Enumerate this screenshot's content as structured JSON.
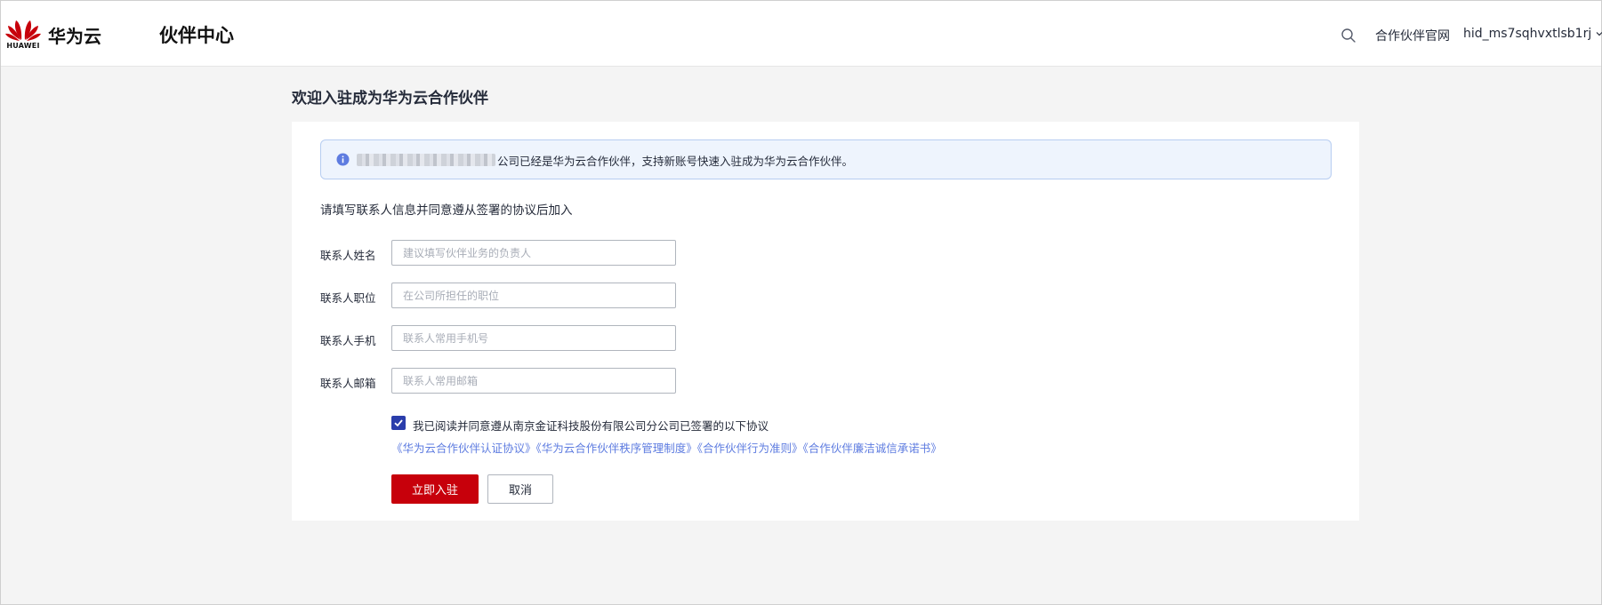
{
  "header": {
    "logo_text": "HUAWEI",
    "brand": "华为云",
    "app_title": "伙伴中心",
    "partner_site_link": "合作伙伴官网",
    "username": "hid_ms7sqhvxtlsb1rj",
    "icons": {
      "search": "search-icon",
      "user_menu": "chevron-down-icon"
    }
  },
  "page": {
    "title": "欢迎入驻成为华为云合作伙伴"
  },
  "alert": {
    "icon": "info-icon",
    "text": "公司已经是华为云合作伙伴，支持新账号快速入驻成为华为云合作伙伴。"
  },
  "form": {
    "instruction": "请填写联系人信息并同意遵从签署的协议后加入",
    "fields": [
      {
        "label": "联系人姓名",
        "value": "",
        "placeholder": "建议填写伙伴业务的负责人"
      },
      {
        "label": "联系人职位",
        "value": "",
        "placeholder": "在公司所担任的职位"
      },
      {
        "label": "联系人手机",
        "value": "",
        "placeholder": "联系人常用手机号"
      },
      {
        "label": "联系人邮箱",
        "value": "",
        "placeholder": "联系人常用邮箱"
      }
    ],
    "agreement": {
      "checked": true,
      "text": "我已阅读并同意遵从南京金证科技股份有限公司分公司已签署的以下协议",
      "links": [
        "《华为云合作伙伴认证协议》",
        "《华为云合作伙伴秩序管理制度》",
        "《合作伙伴行为准则》",
        "《合作伙伴廉洁诚信承诺书》"
      ]
    },
    "submit_label": "立即入驻",
    "cancel_label": "取消"
  },
  "colors": {
    "brand_red": "#c7000b",
    "link_blue": "#5e7ce0",
    "checkbox_blue": "#2a3dab",
    "alert_bg": "#eef4fd",
    "alert_border": "#b7cdf1",
    "page_bg": "#f4f4f4"
  }
}
